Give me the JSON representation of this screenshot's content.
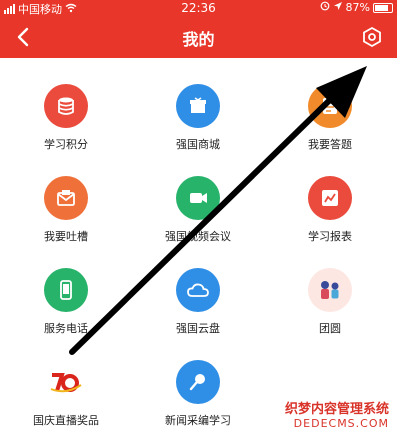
{
  "status": {
    "carrier": "中国移动",
    "time": "22:36",
    "battery": "87%"
  },
  "header": {
    "title": "我的"
  },
  "items": [
    {
      "label": "学习积分",
      "icon": "database-icon",
      "color": "#ea4b3c"
    },
    {
      "label": "强国商城",
      "icon": "gift-icon",
      "color": "#2f8fe6"
    },
    {
      "label": "我要答题",
      "icon": "quiz-icon",
      "color": "#f08a2a"
    },
    {
      "label": "我要吐槽",
      "icon": "mailbox-icon",
      "color": "#f0703a"
    },
    {
      "label": "强国视频会议",
      "icon": "video-camera-icon",
      "color": "#27b36a"
    },
    {
      "label": "学习报表",
      "icon": "chart-icon",
      "color": "#ea4b3c"
    },
    {
      "label": "服务电话",
      "icon": "phone-icon",
      "color": "#27b36a"
    },
    {
      "label": "强国云盘",
      "icon": "cloud-icon",
      "color": "#2f8fe6"
    },
    {
      "label": "团圆",
      "icon": "family-icon",
      "color": "#fde7e2"
    },
    {
      "label": "国庆直播奖品",
      "icon": "national-day-70-icon",
      "color": "#ffffff"
    },
    {
      "label": "新闻采编学习",
      "icon": "microphone-icon",
      "color": "#2f8fe6"
    }
  ],
  "watermark": {
    "line1": "织梦内容管理系统",
    "line2": "DEDECMS.COM"
  }
}
